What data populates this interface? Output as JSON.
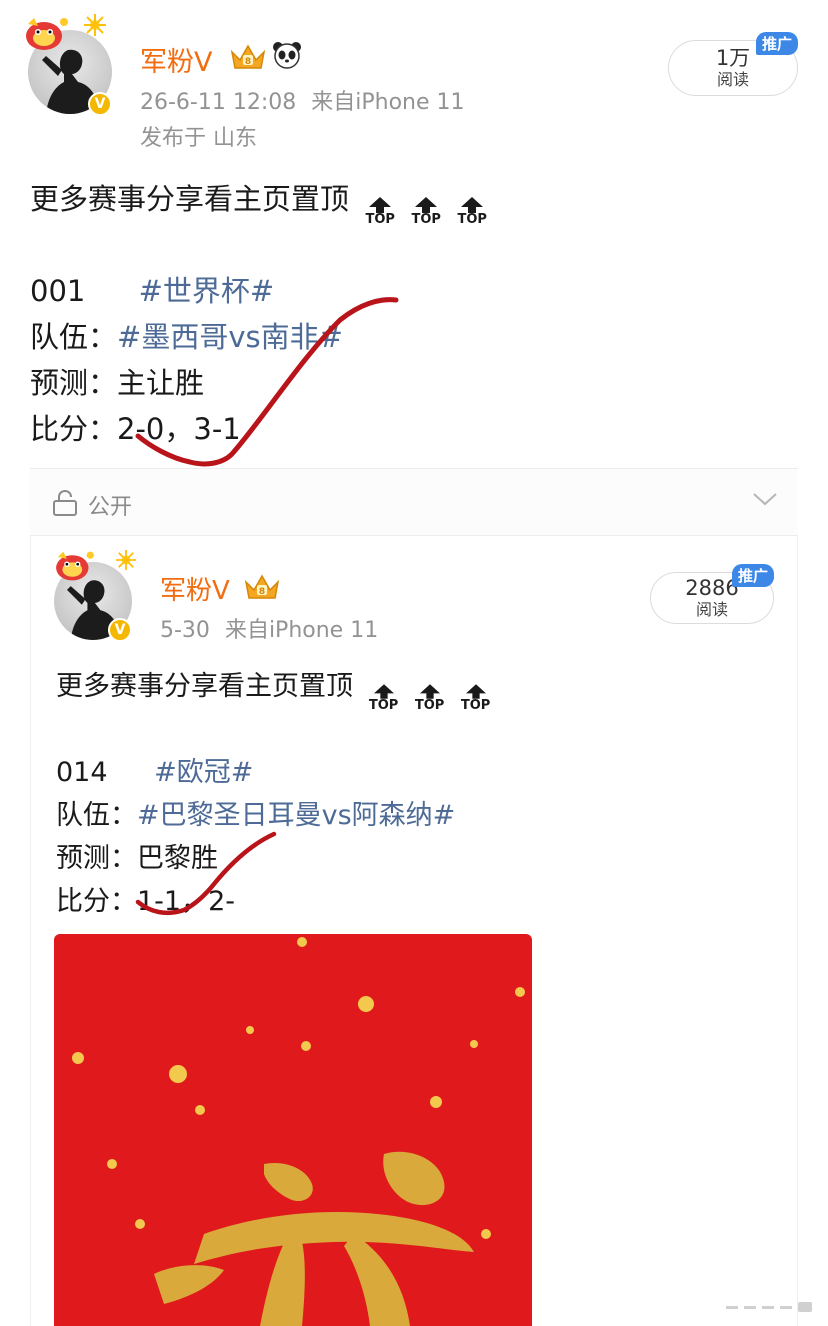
{
  "post1": {
    "username": "军粉V",
    "timestamp": "26-6-11 12:08",
    "source": "来自iPhone 11",
    "location": "发布于 山东",
    "views_count": "1万",
    "views_label": "阅读",
    "promo_tag": "推广",
    "headline": "更多赛事分享看主页置顶",
    "top_icon_label": "TOP",
    "match_no": "001",
    "event_tag": "#世界杯#",
    "team_label": "队伍：",
    "teams": "#墨西哥vs南非#",
    "prediction_label": "预测：",
    "prediction": "主让胜",
    "score_label": "比分：",
    "score": "2-0，3-1"
  },
  "privacy": {
    "label": "公开"
  },
  "post2": {
    "username": "军粉V",
    "timestamp": "5-30",
    "source": "来自iPhone 11",
    "views_count": "2886",
    "views_label": "阅读",
    "promo_tag": "推广",
    "headline": "更多赛事分享看主页置顶",
    "top_icon_label": "TOP",
    "match_no": "014",
    "event_tag": "#欧冠#",
    "team_label": "队伍：",
    "teams": "#巴黎圣日耳曼vs阿森纳#",
    "prediction_label": "预测：",
    "prediction": "巴黎胜",
    "score_label": "比分：",
    "score": "1-1，2-"
  },
  "icons": {
    "crown": "crown-icon",
    "panda": "panda-icon",
    "lock": "lock-icon",
    "chevron": "chevron-down-icon",
    "verified": "verified-badge-icon"
  },
  "colors": {
    "username": "#f26d10",
    "hashtag": "#4d6b96",
    "meta": "#939393",
    "promo": "#3d88e6",
    "verified": "#f5b800",
    "image_bg": "#e0191c",
    "checkmark": "#b8141a"
  },
  "verified_mark": "V"
}
